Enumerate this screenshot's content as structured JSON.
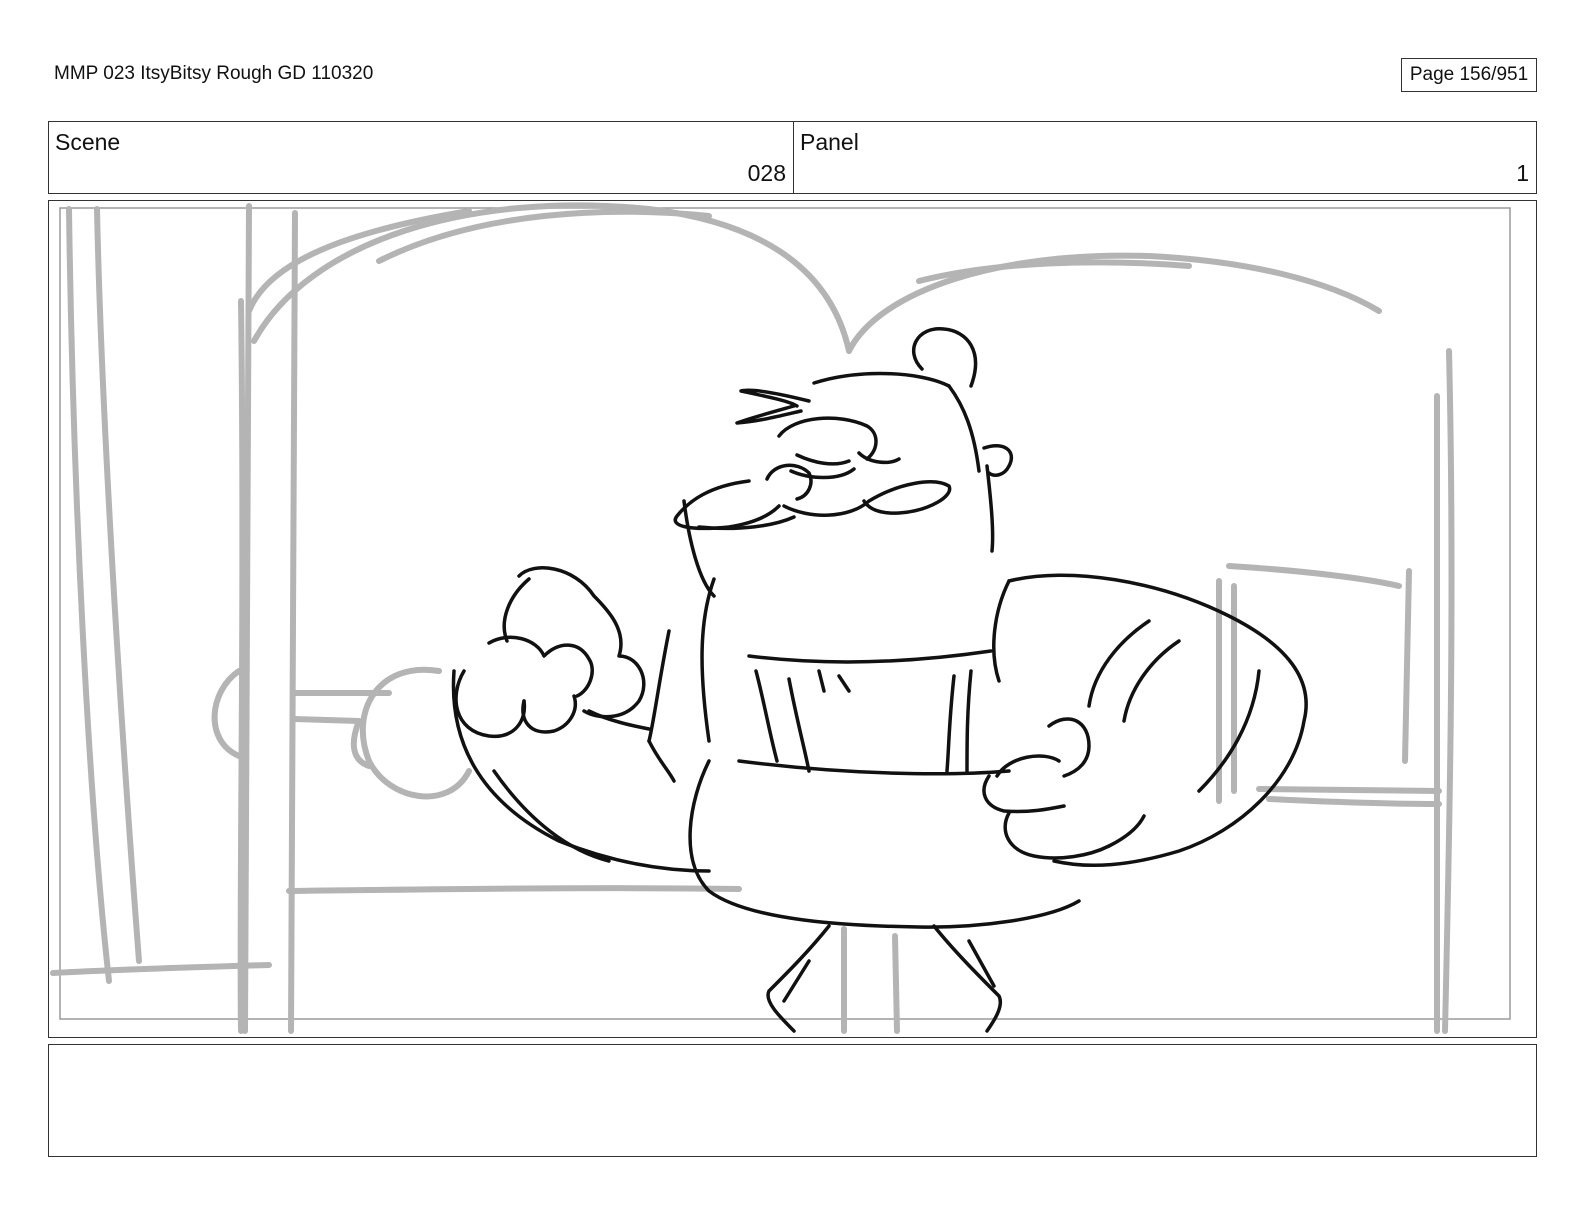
{
  "header": {
    "document_title": "MMP 023 ItsyBitsy Rough GD 110320",
    "page_label": "Page 156/951"
  },
  "scene": {
    "label": "Scene",
    "value": "028"
  },
  "panel": {
    "label": "Panel",
    "value": "1"
  },
  "notes": {
    "text": ""
  },
  "colors": {
    "sketch": "#111111",
    "background_sketch": "#b4b4b4",
    "border": "#333333"
  }
}
